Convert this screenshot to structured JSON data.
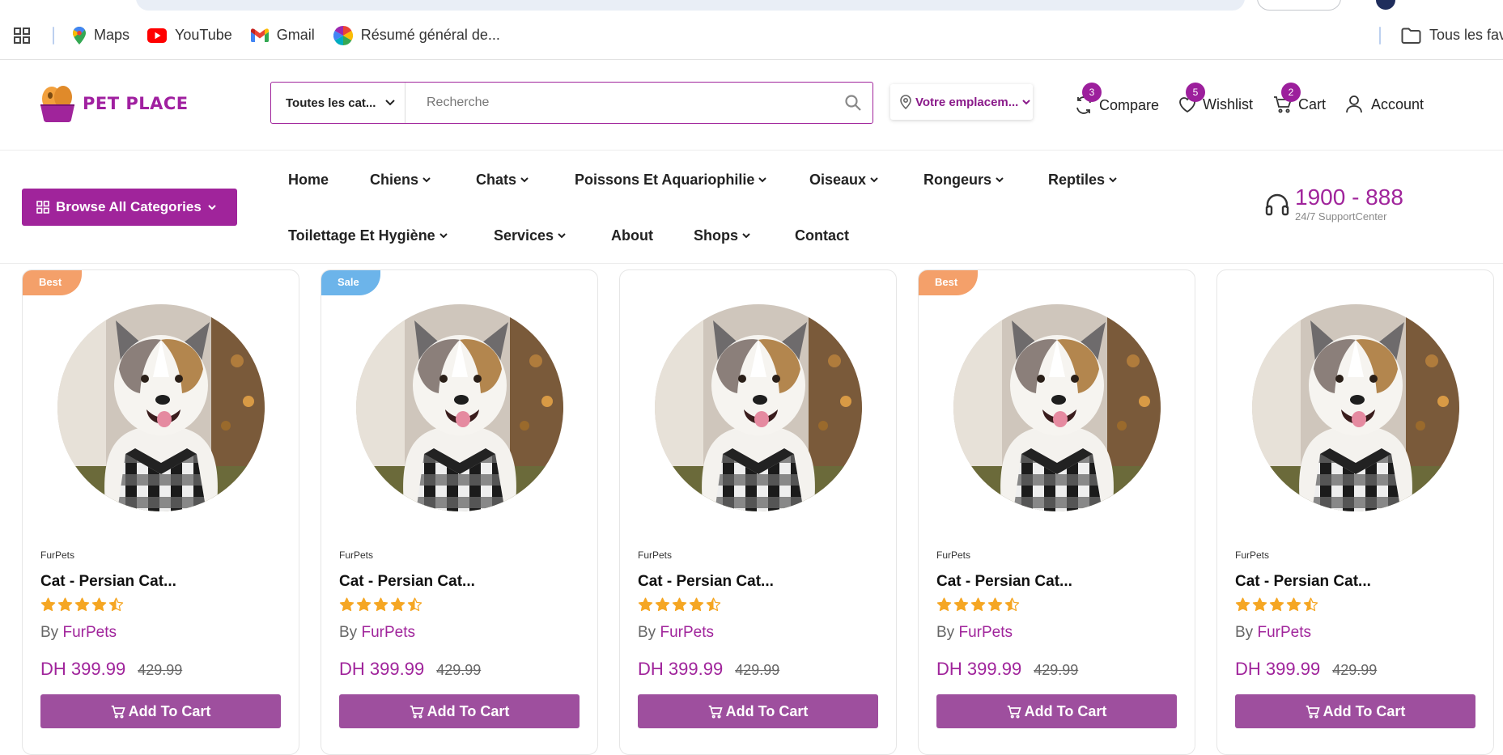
{
  "bookmarks": {
    "items": [
      {
        "label": "Maps",
        "icon": "maps-pin-icon"
      },
      {
        "label": "YouTube",
        "icon": "youtube-icon"
      },
      {
        "label": "Gmail",
        "icon": "gmail-icon"
      },
      {
        "label": "Résumé général de...",
        "icon": "color-wheel-icon"
      }
    ],
    "all_bookmarks": "Tous les fav"
  },
  "header": {
    "logo_text": "PET PLACE",
    "search": {
      "category": "Toutes les cat...",
      "placeholder": "Recherche"
    },
    "location": "Votre emplacem...",
    "compare": {
      "label": "Compare",
      "count": "3"
    },
    "wishlist": {
      "label": "Wishlist",
      "count": "5"
    },
    "cart": {
      "label": "Cart",
      "count": "2"
    },
    "account": {
      "label": "Account"
    }
  },
  "nav": {
    "browse_label": "Browse All Categories",
    "items": [
      {
        "label": "Home",
        "dropdown": false
      },
      {
        "label": "Chiens",
        "dropdown": true
      },
      {
        "label": "Chats",
        "dropdown": true
      },
      {
        "label": "Poissons Et Aquariophilie",
        "dropdown": true
      },
      {
        "label": "Oiseaux",
        "dropdown": true
      },
      {
        "label": "Rongeurs",
        "dropdown": true
      },
      {
        "label": "Reptiles",
        "dropdown": true
      },
      {
        "label": "Toilettage Et Hygiène",
        "dropdown": true
      },
      {
        "label": "Services",
        "dropdown": true
      },
      {
        "label": "About",
        "dropdown": false
      },
      {
        "label": "Shops",
        "dropdown": true
      },
      {
        "label": "Contact",
        "dropdown": false
      }
    ],
    "support_phone": "1900 - 888",
    "support_sub": "24/7 SupportCenter"
  },
  "products": [
    {
      "badge": "Best",
      "badge_type": "best",
      "vendor": "FurPets",
      "title": "Cat - Persian Cat...",
      "rating": 4.5,
      "by_prefix": "By",
      "by_vendor": "FurPets",
      "price": "DH 399.99",
      "old_price": "429.99",
      "cart_label": "Add To Cart"
    },
    {
      "badge": "Sale",
      "badge_type": "sale",
      "vendor": "FurPets",
      "title": "Cat - Persian Cat...",
      "rating": 4.5,
      "by_prefix": "By",
      "by_vendor": "FurPets",
      "price": "DH 399.99",
      "old_price": "429.99",
      "cart_label": "Add To Cart"
    },
    {
      "badge": "",
      "badge_type": "",
      "vendor": "FurPets",
      "title": "Cat - Persian Cat...",
      "rating": 4.5,
      "by_prefix": "By",
      "by_vendor": "FurPets",
      "price": "DH 399.99",
      "old_price": "429.99",
      "cart_label": "Add To Cart"
    },
    {
      "badge": "Best",
      "badge_type": "best",
      "vendor": "FurPets",
      "title": "Cat - Persian Cat...",
      "rating": 4.5,
      "by_prefix": "By",
      "by_vendor": "FurPets",
      "price": "DH 399.99",
      "old_price": "429.99",
      "cart_label": "Add To Cart"
    },
    {
      "badge": "",
      "badge_type": "",
      "vendor": "FurPets",
      "title": "Cat - Persian Cat...",
      "rating": 4.5,
      "by_prefix": "By",
      "by_vendor": "FurPets",
      "price": "DH 399.99",
      "old_price": "429.99",
      "cart_label": "Add To Cart"
    }
  ],
  "colors": {
    "brand": "#a0249b",
    "cart_button": "#9e4f9e",
    "badge_best": "#f4a06a",
    "badge_sale": "#6cb4ea",
    "star": "#f5a623"
  }
}
